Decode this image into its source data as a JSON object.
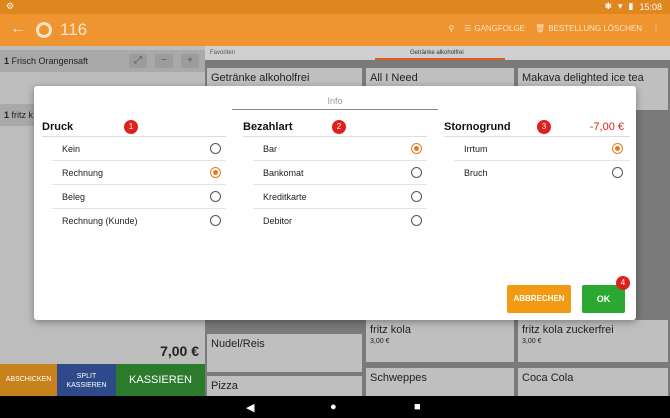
{
  "statusbar": {
    "time": "15:08"
  },
  "appbar": {
    "title_number": "116",
    "gangfolge_label": "GANGFOLGE",
    "bestellung_loeschen_label": "BESTELLUNG LÖSCHEN"
  },
  "order": {
    "items": [
      {
        "qty": "1",
        "name": "Frisch Orangensaft"
      },
      {
        "qty": "1",
        "name": "fritz k"
      }
    ],
    "total": "7,00 €"
  },
  "bottom_buttons": {
    "abschicken": "ABSCHICKEN",
    "split_kassieren": "SPLIT KASSIEREN",
    "kassieren": "KASSIEREN"
  },
  "grid": {
    "tabs": [
      "Favoriten",
      "Getränke alkoholfrei"
    ],
    "tiles": [
      {
        "name": "Getränke alkoholfrei",
        "price": ""
      },
      {
        "name": "All I Need",
        "price": ""
      },
      {
        "name": "Makava delighted ice tea",
        "price": ""
      },
      {
        "name": "fritz kola",
        "price": "3,00 €"
      },
      {
        "name": "fritz kola zuckerfrei",
        "price": "3,00 €"
      },
      {
        "name": "Nudel/Reis",
        "price": ""
      },
      {
        "name": "Pizza",
        "price": ""
      },
      {
        "name": "Schweppes",
        "price": ""
      },
      {
        "name": "Coca Cola",
        "price": ""
      }
    ]
  },
  "dialog": {
    "title": "Info",
    "columns": [
      {
        "header": "Druck",
        "badge": "1",
        "amount": "",
        "options": [
          {
            "label": "Kein",
            "selected": false
          },
          {
            "label": "Rechnung",
            "selected": true
          },
          {
            "label": "Beleg",
            "selected": false
          },
          {
            "label": "Rechnung (Kunde)",
            "selected": false
          }
        ]
      },
      {
        "header": "Bezahlart",
        "badge": "2",
        "amount": "",
        "options": [
          {
            "label": "Bar",
            "selected": true
          },
          {
            "label": "Bankomat",
            "selected": false
          },
          {
            "label": "Kreditkarte",
            "selected": false
          },
          {
            "label": "Debitor",
            "selected": false
          }
        ]
      },
      {
        "header": "Stornogrund",
        "badge": "3",
        "amount": "-7,00 €",
        "options": [
          {
            "label": "Irrtum",
            "selected": true
          },
          {
            "label": "Bruch",
            "selected": false
          }
        ]
      }
    ],
    "cancel_label": "ABBRECHEN",
    "ok_label": "OK",
    "ok_badge": "4"
  },
  "colors": {
    "accent": "#ee9532",
    "ok": "#2aa832",
    "cancel": "#f39a12",
    "badge": "#e0201b"
  }
}
